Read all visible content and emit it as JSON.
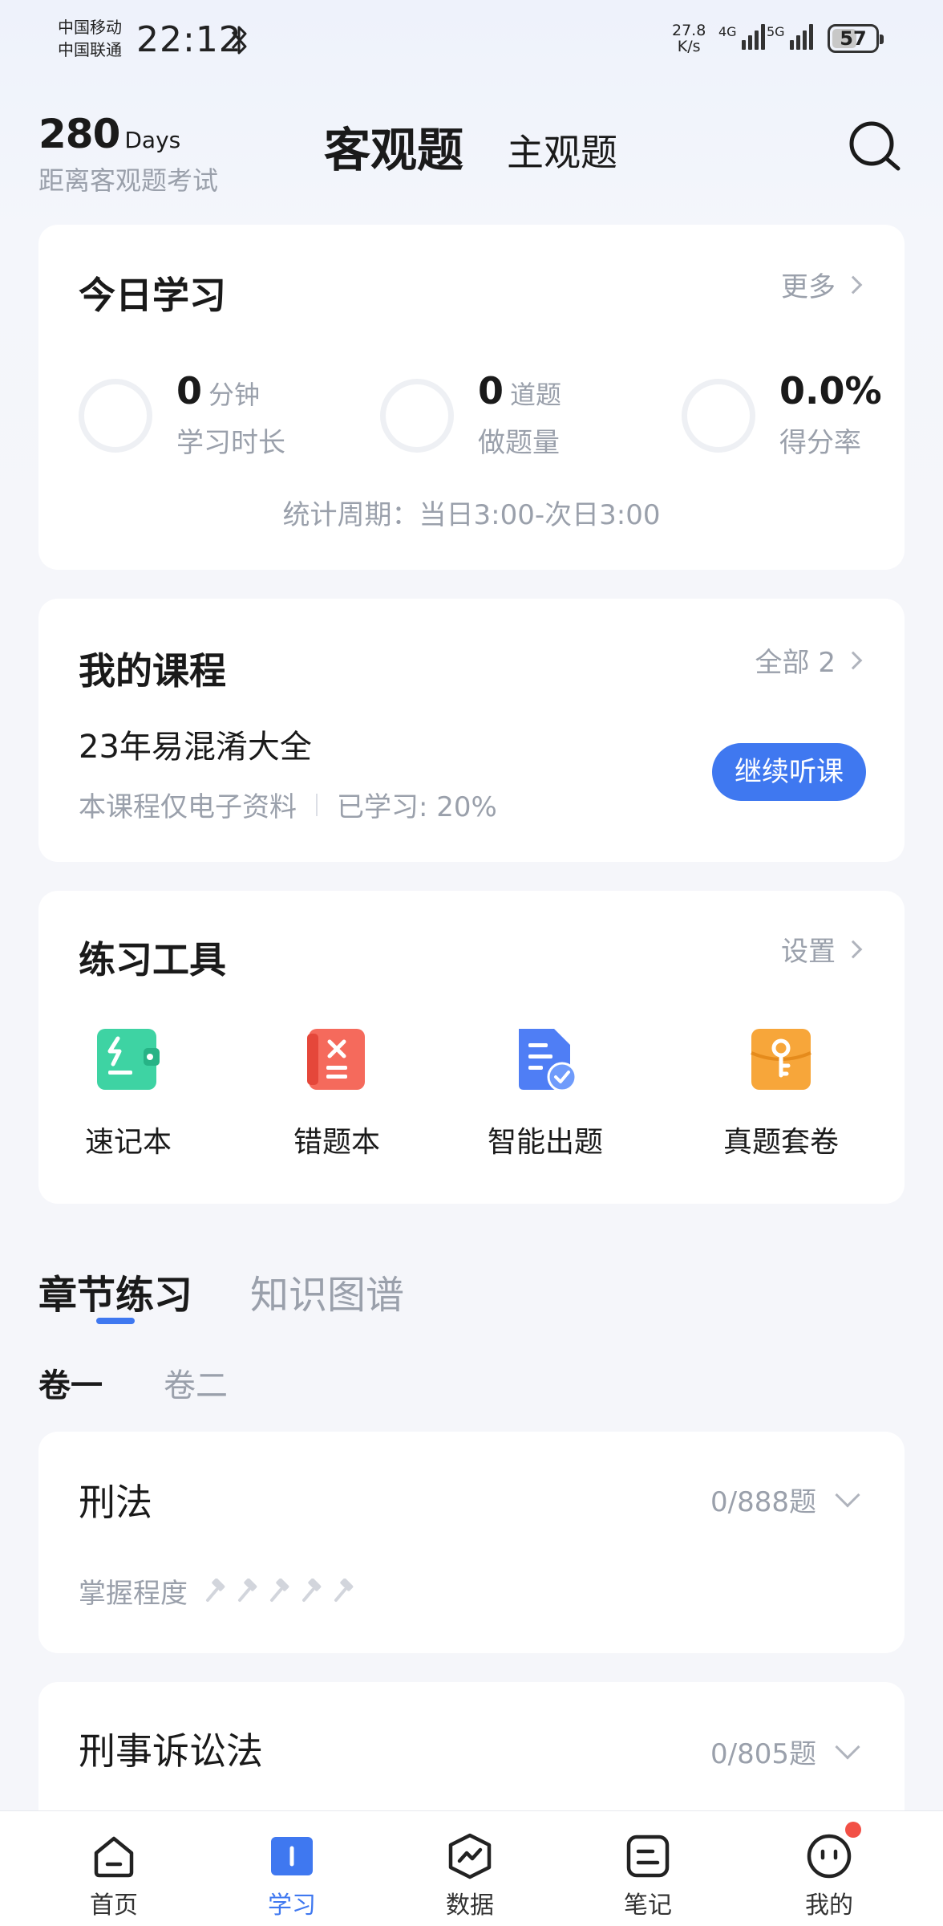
{
  "status_bar": {
    "carrier1": "中国移动",
    "carrier2": "中国联通",
    "time": "22:12",
    "net_speed_value": "27.8",
    "net_speed_unit": "K/s",
    "signal1": "4G",
    "signal2": "5G",
    "battery": "57",
    "battery_level": 0.57
  },
  "header": {
    "countdown_number": "280",
    "countdown_unit": "Days",
    "countdown_label": "距离客观题考试",
    "tab_active": "客观题",
    "tab_inactive": "主观题"
  },
  "today": {
    "title": "今日学习",
    "more": "更多",
    "stats": [
      {
        "value": "0",
        "unit": "分钟",
        "label": "学习时长"
      },
      {
        "value": "0",
        "unit": "道题",
        "label": "做题量"
      },
      {
        "value": "0.0%",
        "unit": "",
        "label": "得分率"
      }
    ],
    "period": "统计周期：当日3:00-次日3:00"
  },
  "courses": {
    "title": "我的课程",
    "all": "全部 2",
    "course_name": "23年易混淆大全",
    "meta_type": "本课程仅电子资料",
    "meta_progress": "已学习: 20%",
    "continue_label": "继续听课"
  },
  "tools": {
    "title": "练习工具",
    "settings": "设置",
    "items": [
      {
        "label": "速记本",
        "icon": "quick-notes-icon",
        "color": "#3ed3a3"
      },
      {
        "label": "错题本",
        "icon": "wrong-questions-icon",
        "color": "#f56a5c"
      },
      {
        "label": "智能出题",
        "icon": "smart-question-icon",
        "color": "#4f7ef5"
      },
      {
        "label": "真题套卷",
        "icon": "past-papers-icon",
        "color": "#f7a63a"
      }
    ]
  },
  "sections": {
    "tab_active": "章节练习",
    "tab_inactive": "知识图谱",
    "vol_active": "卷一",
    "vol_inactive": "卷二"
  },
  "chapters": [
    {
      "title": "刑法",
      "count": "0/888题",
      "mastery_label": "掌握程度",
      "mastery_level": 0
    },
    {
      "title": "刑事诉讼法",
      "count": "0/805题"
    }
  ],
  "bottom_nav": [
    {
      "label": "首页",
      "icon": "home-icon"
    },
    {
      "label": "学习",
      "icon": "study-book-icon"
    },
    {
      "label": "数据",
      "icon": "data-chart-icon"
    },
    {
      "label": "笔记",
      "icon": "notes-icon"
    },
    {
      "label": "我的",
      "icon": "profile-face-icon"
    }
  ],
  "colors": {
    "accent": "#3f78f0",
    "badge": "#f25046"
  }
}
